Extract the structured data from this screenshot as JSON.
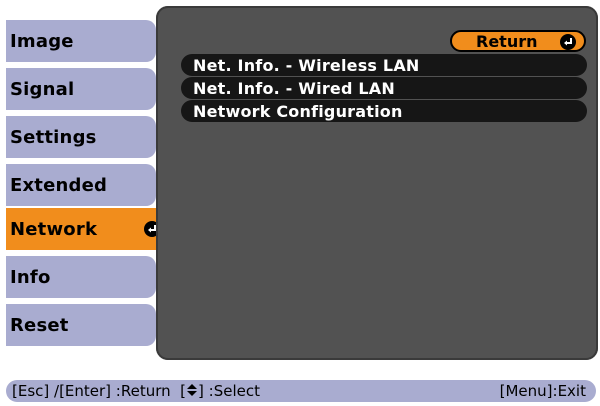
{
  "sidebar": {
    "items": [
      {
        "label": "Image"
      },
      {
        "label": "Signal"
      },
      {
        "label": "Settings"
      },
      {
        "label": "Extended"
      },
      {
        "label": "Network"
      },
      {
        "label": "Info"
      },
      {
        "label": "Reset"
      }
    ],
    "active_index": 4
  },
  "main": {
    "return_label": "Return",
    "items": [
      {
        "label": "Net. Info. - Wireless LAN"
      },
      {
        "label": "Net. Info. - Wired LAN"
      },
      {
        "label": "Network Configuration"
      }
    ]
  },
  "footer": {
    "left_hint_a": "[Esc] /[Enter] :Return  [",
    "left_hint_b": "] :Select",
    "right_hint": "[Menu]:Exit"
  },
  "colors": {
    "sidebar_bg": "#a9acd0",
    "active_bg": "#f18d1c",
    "panel_bg": "#525252",
    "row_bg": "#161616"
  },
  "icons": {
    "enter": "enter-arrow-icon",
    "updown": "up-down-arrows-icon"
  }
}
